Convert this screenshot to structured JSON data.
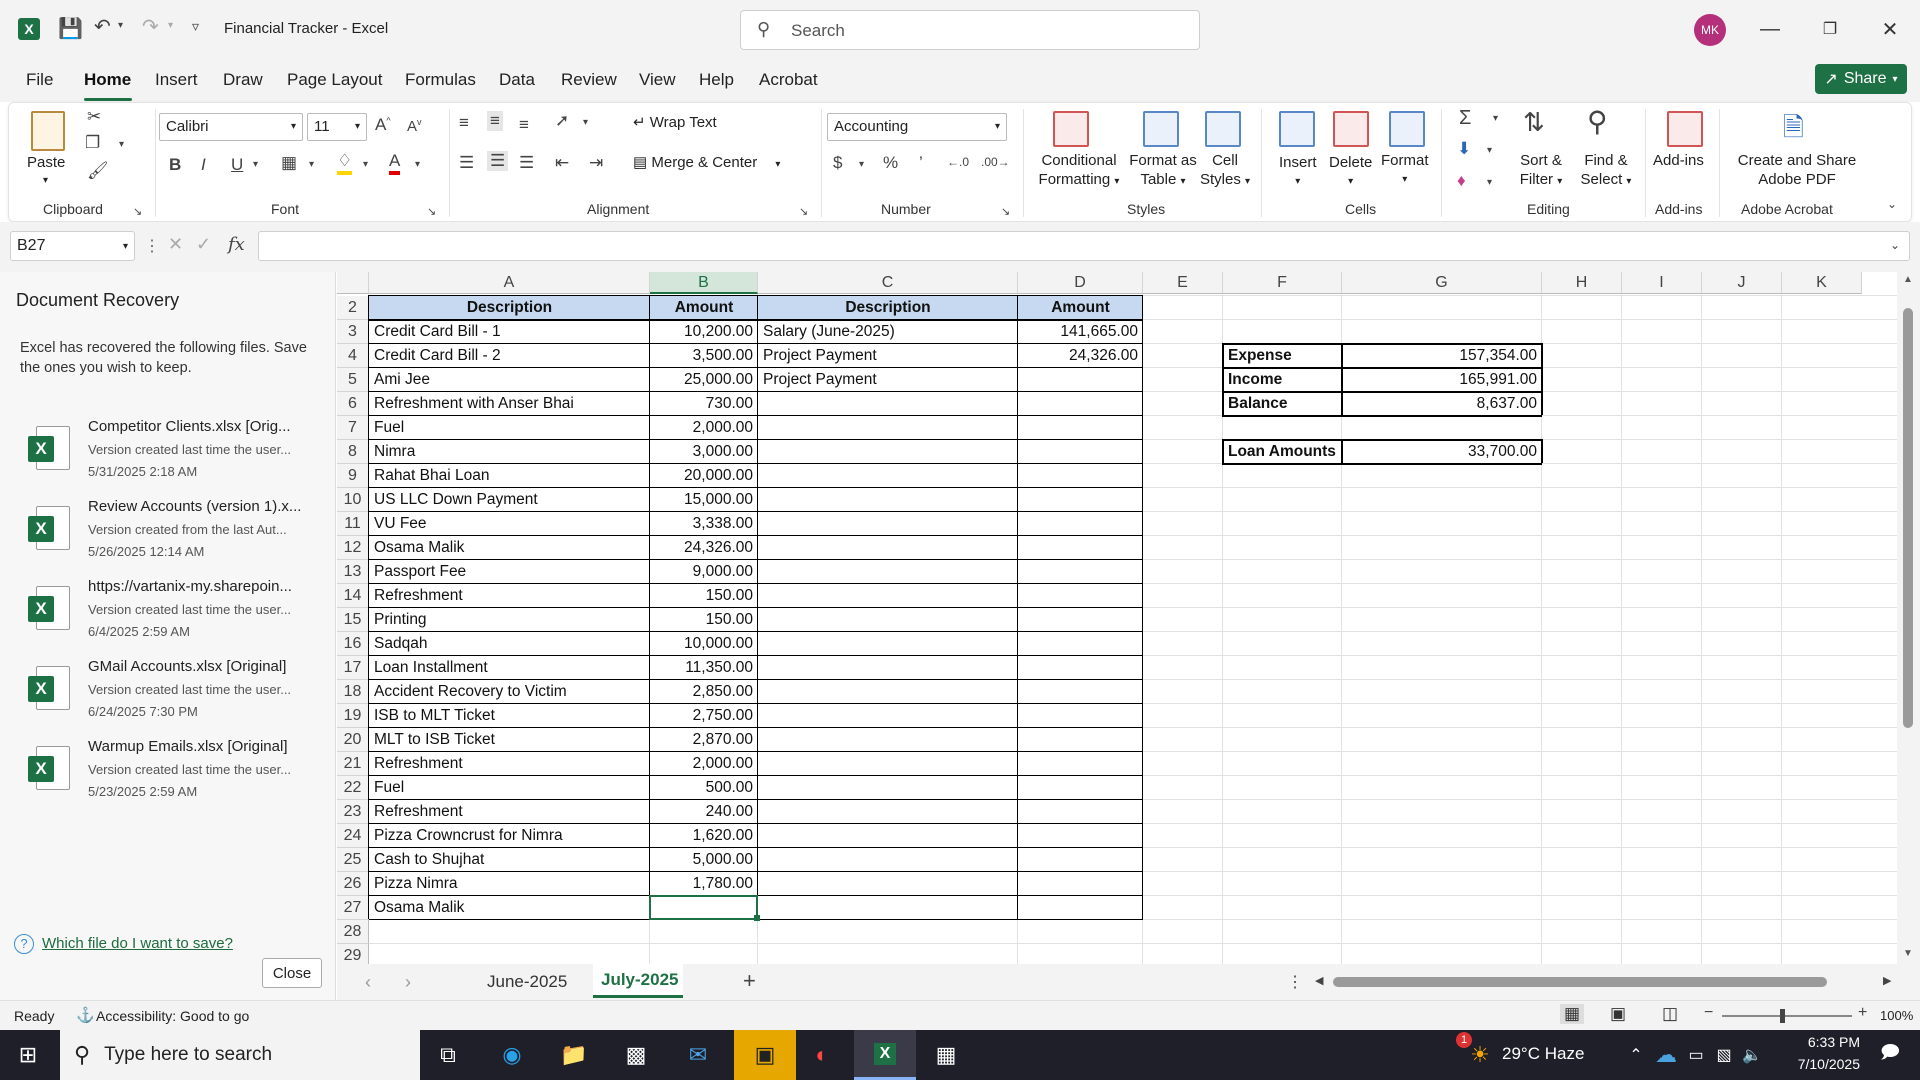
{
  "window": {
    "title": "Financial Tracker  -  Excel",
    "search_placeholder": "Search",
    "avatar_initials": "MK",
    "share_label": "Share"
  },
  "menu": [
    "File",
    "Home",
    "Insert",
    "Draw",
    "Page Layout",
    "Formulas",
    "Data",
    "Review",
    "View",
    "Help",
    "Acrobat"
  ],
  "ribbon": {
    "clipboard": {
      "paste": "Paste",
      "label": "Clipboard"
    },
    "font": {
      "name": "Calibri",
      "size": "11",
      "label": "Font"
    },
    "alignment": {
      "wrap": "Wrap Text",
      "merge": "Merge & Center",
      "label": "Alignment"
    },
    "number": {
      "format": "Accounting",
      "label": "Number"
    },
    "styles": {
      "cond1": "Conditional",
      "cond2": "Formatting",
      "fmt1": "Format as",
      "fmt2": "Table",
      "cell1": "Cell",
      "cell2": "Styles",
      "label": "Styles"
    },
    "cells": {
      "insert": "Insert",
      "delete": "Delete",
      "format": "Format",
      "label": "Cells"
    },
    "editing": {
      "sort1": "Sort &",
      "sort2": "Filter",
      "find1": "Find &",
      "find2": "Select",
      "label": "Editing"
    },
    "addins": {
      "btn": "Add-ins",
      "label": "Add-ins"
    },
    "acrobat": {
      "b1": "Create and Share",
      "b2": "Adobe PDF",
      "label": "Adobe Acrobat"
    }
  },
  "formula_bar": {
    "name_box": "B27",
    "fx": "fx"
  },
  "recovery": {
    "title": "Document Recovery",
    "description": "Excel has recovered the following files. Save the ones you wish to keep.",
    "items": [
      {
        "name": "Competitor Clients.xlsx  [Orig...",
        "sub": "Version created last time the user...",
        "date": "5/31/2025 2:18 AM"
      },
      {
        "name": "Review Accounts (version 1).x...",
        "sub": "Version created from the last Aut...",
        "date": "5/26/2025 12:14 AM"
      },
      {
        "name": "https://vartanix-my.sharepoin...",
        "sub": "Version created last time the user...",
        "date": "6/4/2025 2:59 AM"
      },
      {
        "name": "GMail Accounts.xlsx  [Original]",
        "sub": "Version created last time the user...",
        "date": "6/24/2025 7:30 PM"
      },
      {
        "name": "Warmup Emails.xlsx  [Original]",
        "sub": "Version created last time the user...",
        "date": "5/23/2025 2:59 AM"
      }
    ],
    "help_link": "Which file do I want to save?",
    "close": "Close"
  },
  "sheet": {
    "columns": [
      "A",
      "B",
      "C",
      "D",
      "E",
      "F",
      "G",
      "H",
      "I",
      "J",
      "K"
    ],
    "header_row": {
      "row": "2",
      "a": "Description",
      "b": "Amount",
      "c": "Description",
      "d": "Amount"
    },
    "rows": [
      {
        "n": "3",
        "a": "Credit Card Bill - 1",
        "b": "10,200.00",
        "c": "Salary (June-2025)",
        "d": "141,665.00"
      },
      {
        "n": "4",
        "a": "Credit Card Bill - 2",
        "b": "3,500.00",
        "c": "Project Payment",
        "d": "24,326.00"
      },
      {
        "n": "5",
        "a": "Ami Jee",
        "b": "25,000.00",
        "c": "Project Payment",
        "d": ""
      },
      {
        "n": "6",
        "a": "Refreshment with Anser Bhai",
        "b": "730.00",
        "c": "",
        "d": ""
      },
      {
        "n": "7",
        "a": "Fuel",
        "b": "2,000.00",
        "c": "",
        "d": ""
      },
      {
        "n": "8",
        "a": "Nimra",
        "b": "3,000.00",
        "c": "",
        "d": ""
      },
      {
        "n": "9",
        "a": "Rahat Bhai Loan",
        "b": "20,000.00",
        "c": "",
        "d": ""
      },
      {
        "n": "10",
        "a": "US LLC Down Payment",
        "b": "15,000.00",
        "c": "",
        "d": ""
      },
      {
        "n": "11",
        "a": "VU Fee",
        "b": "3,338.00",
        "c": "",
        "d": ""
      },
      {
        "n": "12",
        "a": "Osama Malik",
        "b": "24,326.00",
        "c": "",
        "d": ""
      },
      {
        "n": "13",
        "a": "Passport Fee",
        "b": "9,000.00",
        "c": "",
        "d": ""
      },
      {
        "n": "14",
        "a": "Refreshment",
        "b": "150.00",
        "c": "",
        "d": ""
      },
      {
        "n": "15",
        "a": "Printing",
        "b": "150.00",
        "c": "",
        "d": ""
      },
      {
        "n": "16",
        "a": "Sadqah",
        "b": "10,000.00",
        "c": "",
        "d": ""
      },
      {
        "n": "17",
        "a": "Loan Installment",
        "b": "11,350.00",
        "c": "",
        "d": ""
      },
      {
        "n": "18",
        "a": "Accident Recovery to Victim",
        "b": "2,850.00",
        "c": "",
        "d": ""
      },
      {
        "n": "19",
        "a": "ISB to MLT Ticket",
        "b": "2,750.00",
        "c": "",
        "d": ""
      },
      {
        "n": "20",
        "a": "MLT to ISB Ticket",
        "b": "2,870.00",
        "c": "",
        "d": ""
      },
      {
        "n": "21",
        "a": "Refreshment",
        "b": "2,000.00",
        "c": "",
        "d": ""
      },
      {
        "n": "22",
        "a": "Fuel",
        "b": "500.00",
        "c": "",
        "d": ""
      },
      {
        "n": "23",
        "a": "Refreshment",
        "b": "240.00",
        "c": "",
        "d": ""
      },
      {
        "n": "24",
        "a": "Pizza Crowncrust for Nimra",
        "b": "1,620.00",
        "c": "",
        "d": ""
      },
      {
        "n": "25",
        "a": "Cash to Shujhat",
        "b": "5,000.00",
        "c": "",
        "d": ""
      },
      {
        "n": "26",
        "a": "Pizza Nimra",
        "b": "1,780.00",
        "c": "",
        "d": ""
      },
      {
        "n": "27",
        "a": "Osama Malik",
        "b": "",
        "c": "",
        "d": ""
      },
      {
        "n": "28",
        "a": "",
        "b": "",
        "c": "",
        "d": ""
      },
      {
        "n": "29",
        "a": "",
        "b": "",
        "c": "",
        "d": ""
      }
    ],
    "summary": [
      {
        "label": "Expense",
        "value": "157,354.00"
      },
      {
        "label": "Income",
        "value": "165,991.00"
      },
      {
        "label": "Balance",
        "value": "8,637.00"
      }
    ],
    "loan": {
      "label": "Loan Amounts",
      "value": "33,700.00"
    }
  },
  "tabs": [
    "June-2025",
    "July-2025"
  ],
  "status": {
    "ready": "Ready",
    "accessibility": "Accessibility: Good to go",
    "zoom": "100%"
  },
  "taskbar": {
    "search": "Type here to search",
    "weather": "29°C  Haze",
    "time": "6:33 PM",
    "date": "7/10/2025",
    "notif": "1"
  }
}
